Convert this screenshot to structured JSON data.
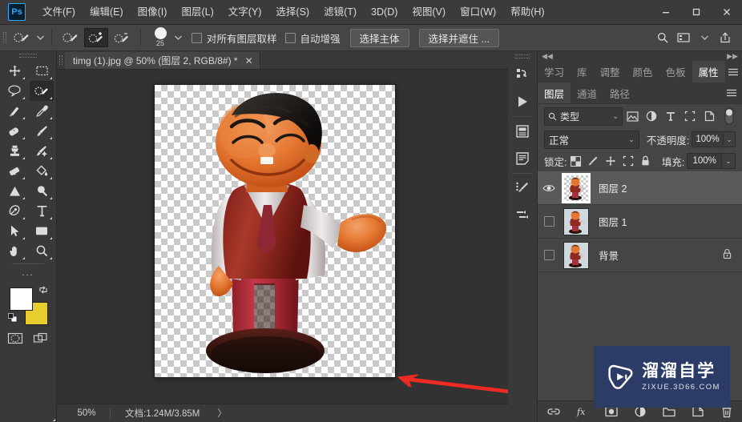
{
  "app": {
    "logo_text": "Ps",
    "menus": [
      {
        "label": "文件(F)"
      },
      {
        "label": "编辑(E)"
      },
      {
        "label": "图像(I)"
      },
      {
        "label": "图层(L)"
      },
      {
        "label": "文字(Y)"
      },
      {
        "label": "选择(S)"
      },
      {
        "label": "滤镜(T)"
      },
      {
        "label": "3D(D)"
      },
      {
        "label": "视图(V)"
      },
      {
        "label": "窗口(W)"
      },
      {
        "label": "帮助(H)"
      }
    ],
    "window_controls": [
      {
        "name": "minimize-button",
        "glyph": "—"
      },
      {
        "name": "maximize-button",
        "glyph": "▢"
      },
      {
        "name": "close-button",
        "glyph": "✕"
      }
    ]
  },
  "options_bar": {
    "tool_preset_icon": "quick-selection-tool-icon",
    "modes": [
      {
        "name": "new-selection-mode",
        "icon": "quick-selection-new-icon",
        "active": false
      },
      {
        "name": "add-to-selection-mode",
        "icon": "quick-selection-add-icon",
        "active": true
      },
      {
        "name": "subtract-from-selection-mode",
        "icon": "quick-selection-subtract-icon",
        "active": false
      }
    ],
    "brush_size": "25",
    "checkboxes": [
      {
        "label": "对所有图层取样",
        "checked": false
      },
      {
        "label": "自动增强",
        "checked": false
      }
    ],
    "buttons": [
      {
        "label": "选择主体"
      },
      {
        "label": "选择并遮住 ..."
      }
    ],
    "right_icons": [
      {
        "name": "search-icon"
      },
      {
        "name": "workspace-switcher-icon"
      },
      {
        "name": "share-icon"
      }
    ]
  },
  "toolbox": {
    "tools": [
      {
        "name": "move-tool",
        "icon": "move-icon",
        "active": false
      },
      {
        "name": "rectangular-marquee-tool",
        "icon": "marquee-icon",
        "active": false
      },
      {
        "name": "lasso-tool",
        "icon": "lasso-icon",
        "active": false
      },
      {
        "name": "quick-selection-tool",
        "icon": "quick-selection-icon",
        "active": true
      },
      {
        "name": "crop-tool",
        "icon": "crop-icon",
        "active": false
      },
      {
        "name": "eyedropper-tool",
        "icon": "eyedropper-icon",
        "active": false
      },
      {
        "name": "healing-brush-tool",
        "icon": "healing-brush-icon",
        "active": false
      },
      {
        "name": "brush-tool",
        "icon": "brush-icon",
        "active": false
      },
      {
        "name": "clone-stamp-tool",
        "icon": "clone-stamp-icon",
        "active": false
      },
      {
        "name": "history-brush-tool",
        "icon": "history-brush-icon",
        "active": false
      },
      {
        "name": "eraser-tool",
        "icon": "eraser-icon",
        "active": false
      },
      {
        "name": "paint-bucket-tool",
        "icon": "paint-bucket-icon",
        "active": false
      },
      {
        "name": "blur-tool",
        "icon": "gradient-triangle-icon",
        "active": false
      },
      {
        "name": "dodge-tool",
        "icon": "dodge-icon",
        "active": false
      },
      {
        "name": "pen-tool",
        "icon": "pen-icon",
        "active": false
      },
      {
        "name": "type-tool",
        "icon": "type-t-icon",
        "active": false
      },
      {
        "name": "path-selection-tool",
        "icon": "path-arrow-icon",
        "active": false
      },
      {
        "name": "rectangle-tool",
        "icon": "rectangle-shape-icon",
        "active": false
      },
      {
        "name": "hand-tool",
        "icon": "hand-icon",
        "active": false
      },
      {
        "name": "zoom-tool",
        "icon": "magnifier-icon",
        "active": false
      }
    ],
    "more_tools": "...",
    "foreground_color": "#ffffff",
    "background_color": "#e8ce2c",
    "swap_icon": "swap-colors-icon",
    "default_icon": "default-colors-icon",
    "quick_mask_icon": "quick-mask-icon",
    "screen_mode_icon": "screen-mode-icon"
  },
  "document": {
    "tab_title": "timg (1).jpg @ 50% (图层 2, RGB/8#) *",
    "close_glyph": "✕",
    "annotation": {
      "name": "red-arrow-annotation",
      "color": "#ee2b22"
    }
  },
  "status_bar": {
    "zoom": "50%",
    "doc_info": "文档:1.24M/3.85M",
    "expand_glyph": "〉"
  },
  "dock_strip": {
    "buttons": [
      {
        "name": "history-panel-icon"
      },
      {
        "name": "actions-play-icon"
      },
      {
        "name": "libraries-panel-icon"
      },
      {
        "name": "notes-panel-icon"
      },
      {
        "name": "brush-settings-icon"
      },
      {
        "name": "brushes-panel-icon"
      }
    ]
  },
  "right_panel": {
    "top_tabs": [
      {
        "label": "学习",
        "active": false
      },
      {
        "label": "库",
        "active": false
      },
      {
        "label": "调整",
        "active": false
      },
      {
        "label": "颜色",
        "active": false
      },
      {
        "label": "色板",
        "active": false
      },
      {
        "label": "属性",
        "active": true
      }
    ],
    "top_menu_icon": "panel-menu-icon",
    "layer_tabs": [
      {
        "label": "图层",
        "active": true
      },
      {
        "label": "通道",
        "active": false
      },
      {
        "label": "路径",
        "active": false
      }
    ],
    "layer_menu_icon": "panel-menu-icon",
    "filter": {
      "search_icon": "search-icon",
      "type_label": "类型",
      "chevron": "⌄",
      "icons": [
        {
          "name": "filter-pixel-icon"
        },
        {
          "name": "filter-adjustment-icon"
        },
        {
          "name": "filter-type-icon"
        },
        {
          "name": "filter-shape-icon"
        },
        {
          "name": "filter-smart-object-icon"
        }
      ],
      "toggle_name": "filter-toggle-switch"
    },
    "blend": {
      "mode": "正常",
      "chevron": "⌄",
      "opacity_label": "不透明度:",
      "opacity_value": "100%"
    },
    "lock": {
      "label": "锁定:",
      "icons": [
        {
          "name": "lock-transparent-pixels-icon"
        },
        {
          "name": "lock-image-pixels-icon"
        },
        {
          "name": "lock-position-icon"
        },
        {
          "name": "lock-artboard-nesting-icon"
        },
        {
          "name": "lock-all-icon"
        }
      ],
      "fill_label": "填充:",
      "fill_value": "100%"
    },
    "layers": [
      {
        "name": "图层 2",
        "visible": true,
        "selected": true,
        "locked": false,
        "transparent_thumb": true
      },
      {
        "name": "图层 1",
        "visible": false,
        "selected": false,
        "locked": false,
        "transparent_thumb": false
      },
      {
        "name": "背景",
        "visible": false,
        "selected": false,
        "locked": true,
        "transparent_thumb": false
      }
    ],
    "bottom_buttons": [
      {
        "name": "link-layers-button",
        "icon": "link-icon"
      },
      {
        "name": "layer-style-button",
        "icon": "fx-icon"
      },
      {
        "name": "add-layer-mask-button",
        "icon": "mask-icon"
      },
      {
        "name": "new-adjustment-layer-button",
        "icon": "adjustment-icon"
      },
      {
        "name": "new-group-button",
        "icon": "folder-icon"
      },
      {
        "name": "new-layer-button",
        "icon": "new-layer-icon"
      },
      {
        "name": "delete-layer-button",
        "icon": "trash-icon"
      }
    ]
  },
  "watermark": {
    "title": "溜溜自学",
    "url": "ZIXUE.3D66.COM",
    "icon": "play-logo-icon",
    "bg_color": "#2c3c67"
  }
}
